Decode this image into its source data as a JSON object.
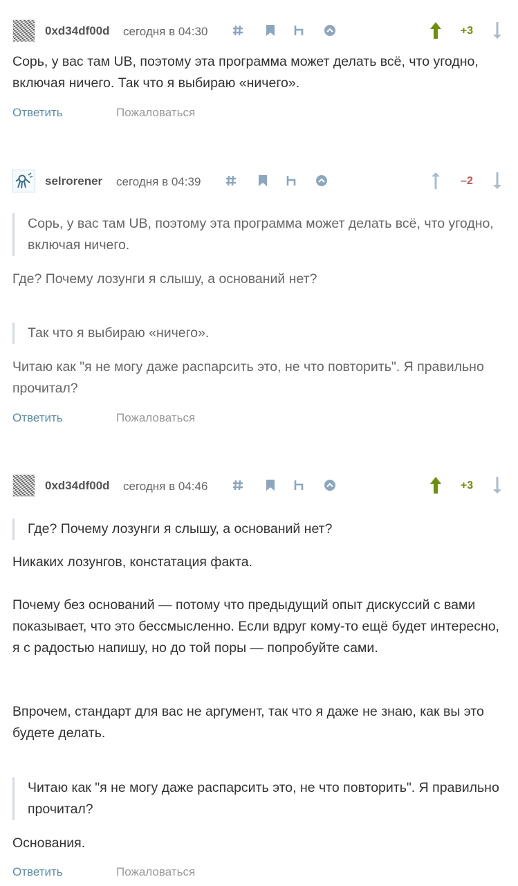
{
  "comments": [
    {
      "username": "0xd34df00d",
      "timestamp": "сегодня в 04:30",
      "score": "+3",
      "score_color": "#6c9007",
      "upvote_color": "#6c9007",
      "body": [
        "Сорь, у вас там UB, поэтому эта программа может делать всё, что угодно, включая ничего. Так что я выбираю «ничего»."
      ],
      "actions": {
        "reply": "Ответить",
        "report": "Пожаловаться"
      }
    },
    {
      "username": "selrorener",
      "timestamp": "сегодня в 04:39",
      "score": "–2",
      "score_color": "#d04e4e",
      "upvote_color": "#a9bccc",
      "quote_1": "Сорь, у вас там UB, поэтому эта программа может делать всё, что угодно, включая ничего.",
      "text_1": "Где? Почему лозунги я слышу, а оснований нет?",
      "quote_2": "Так что я выбираю «ничего».",
      "text_2": "Читаю как \"я не могу даже распарсить это, не что повторить\". Я правильно прочитал?",
      "actions": {
        "reply": "Ответить",
        "report": "Пожаловаться"
      }
    },
    {
      "username": "0xd34df00d",
      "timestamp": "сегодня в 04:46",
      "score": "+3",
      "score_color": "#6c9007",
      "upvote_color": "#6c9007",
      "quote_1": "Где? Почему лозунги я слышу, а оснований нет?",
      "text_1": "Никаких лозунгов, констатация факта.",
      "text_2": "Почему без оснований — потому что предыдущий опыт дискуссий с вами показывает, что это бессмысленно. Если вдруг кому-то ещё будет интересно, я с радостью напишу, но до той поры — попробуйте сами.",
      "text_3": "Впрочем, стандарт для вас не аргумент, так что я даже не знаю, как вы это будете делать.",
      "quote_2": "Читаю как \"я не могу даже распарсить это, не что повторить\". Я правильно прочитал?",
      "text_4": "Основания.",
      "actions": {
        "reply": "Ответить",
        "report": "Пожаловаться"
      }
    }
  ],
  "icons": {
    "hash": "hash-icon",
    "bookmark": "bookmark-icon",
    "parent": "parent-comment-icon",
    "collapse": "collapse-icon",
    "upvote": "arrow-up-icon",
    "downvote": "arrow-down-icon"
  },
  "colors": {
    "link": "#548eaa",
    "meta_icon": "#8aa6c1",
    "positive": "#6c9007",
    "negative": "#d04e4e",
    "quote_border": "#d5dde4"
  }
}
